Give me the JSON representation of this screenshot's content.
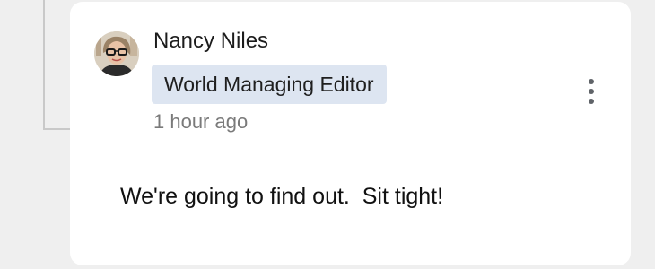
{
  "comment": {
    "author": {
      "name": "Nancy Niles",
      "role": "World Managing Editor",
      "avatar_icon": "profile-photo"
    },
    "timestamp": "1 hour ago",
    "body": "We're going to find out.  Sit tight!",
    "more_icon": "more-vertical-icon"
  },
  "colors": {
    "role_badge_bg": "#dde5f1",
    "timestamp": "#7a7a7a",
    "card_bg": "#ffffff",
    "page_bg": "#efefef"
  }
}
